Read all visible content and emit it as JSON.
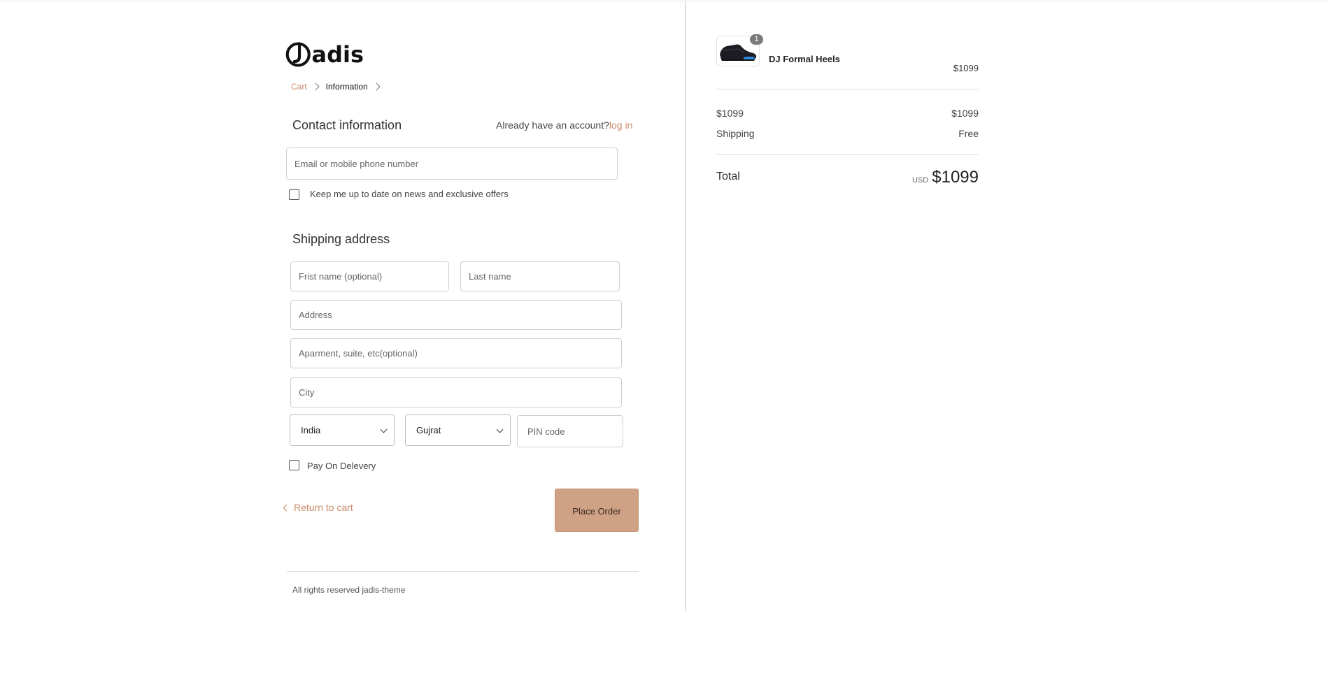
{
  "brand": {
    "logo_text": "adis",
    "logo_label": "Jadis"
  },
  "breadcrumb": {
    "cart": "Cart",
    "information": "Information"
  },
  "contact": {
    "heading": "Contact information",
    "account_prompt": "Already have an account?",
    "login_link": "log in",
    "email_placeholder": "Email or mobile phone number",
    "newsletter_label": "Keep me up to date on news and exclusive offers"
  },
  "shipping": {
    "heading": "Shipping address",
    "first_name_placeholder": "Frist name (optional)",
    "last_name_placeholder": "Last name",
    "address_placeholder": "Address",
    "apartment_placeholder": "Aparment, suite, etc(optional)",
    "city_placeholder": "City",
    "country": "India",
    "state": "Gujrat",
    "pin_placeholder": "PIN code",
    "pay_on_delivery_label": "Pay On Delevery"
  },
  "actions": {
    "return_label": "Return to cart",
    "place_order_label": "Place Order"
  },
  "footer": {
    "text": "All rights reserved jadis-theme"
  },
  "summary": {
    "item": {
      "name": "DJ Formal Heels",
      "quantity": "1",
      "price": "$1099",
      "image_icon": "sneaker-icon"
    },
    "subtotal_label": "$1099",
    "subtotal_value": "$1099",
    "shipping_label": "Shipping",
    "shipping_value": "Free",
    "total_label": "Total",
    "total_currency": "USD",
    "total_value": "$1099"
  },
  "colors": {
    "accent": "#c98b6b",
    "button_bg": "#cfa286",
    "divider": "#e1e1e1"
  }
}
